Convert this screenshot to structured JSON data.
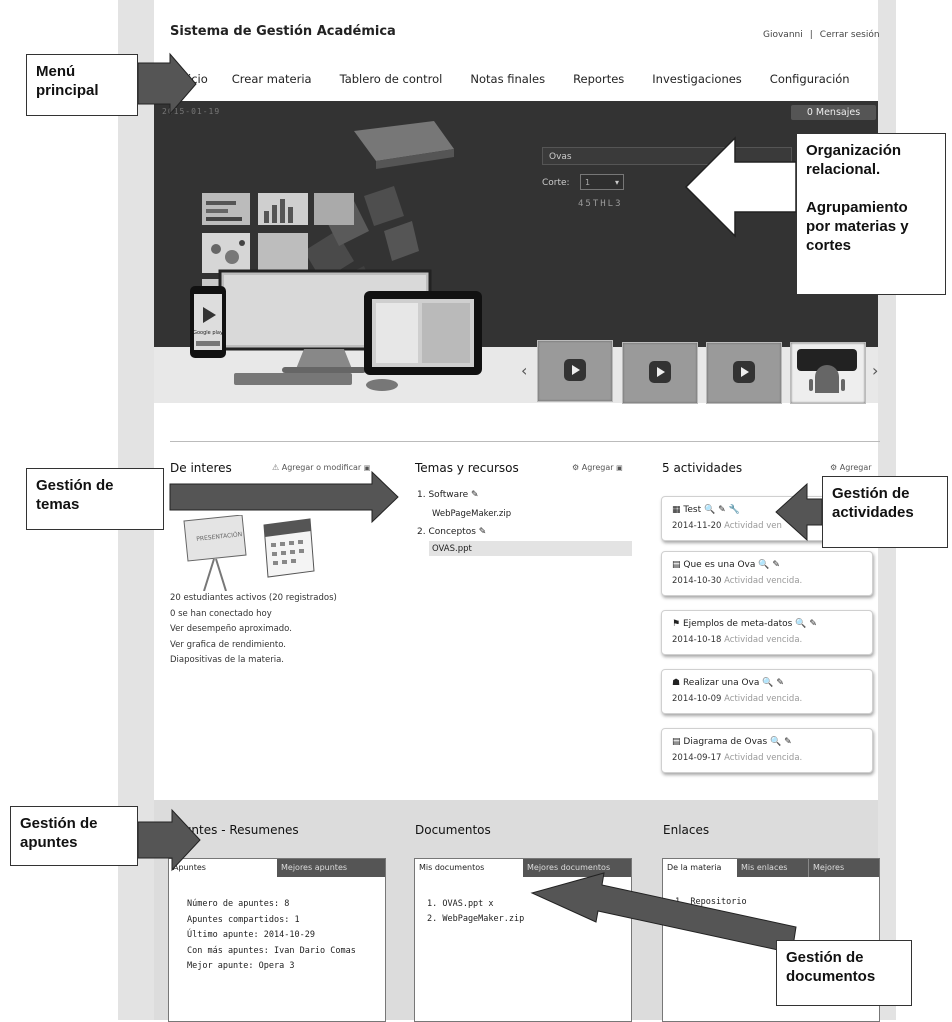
{
  "header": {
    "app_title": "Sistema de Gestión Académica",
    "user_name": "Giovanni",
    "separator": "|",
    "logout_label": "Cerrar sesión"
  },
  "nav": {
    "items": [
      "icio",
      "Crear materia",
      "Tablero de control",
      "Notas finales",
      "Reportes",
      "Investigaciones",
      "Configuración"
    ]
  },
  "banner": {
    "date": "2015-01-19",
    "messages_label": "0 Mensajes",
    "subject_value": "Ovas",
    "corte_label": "Corte:",
    "corte_value": "1",
    "corte_code": "45THL3",
    "store_label": "Google play"
  },
  "interest": {
    "title": "De interes",
    "edit_label": "Agregar o modificar",
    "lines": [
      "20 estudiantes activos (20 registrados)",
      "0 se han conectado hoy",
      "Ver desempeño aproximado.",
      "Ver grafica de rendimiento.",
      "Diapositivas de la materia."
    ],
    "board_text": "PRESENTACIÓN"
  },
  "topics": {
    "title": "Temas y recursos",
    "add_label": "Agregar",
    "items": [
      {
        "num": "1.",
        "name": "Software",
        "file": "WebPageMaker.zip"
      },
      {
        "num": "2.",
        "name": "Conceptos",
        "file": "OVAS.ppt"
      }
    ]
  },
  "activities": {
    "title": "5 actividades",
    "add_label": "Agregar",
    "status_text": "Actividad vencida.",
    "items": [
      {
        "name": "Test",
        "date": "2014-11-20",
        "status": "Actividad ven"
      },
      {
        "name": "Que es una Ova",
        "date": "2014-10-30",
        "status": "Actividad vencida."
      },
      {
        "name": "Ejemplos de meta-datos",
        "date": "2014-10-18",
        "status": "Actividad vencida."
      },
      {
        "name": "Realizar una Ova",
        "date": "2014-10-09",
        "status": "Actividad vencida."
      },
      {
        "name": "Diagrama de Ovas",
        "date": "2014-09-17",
        "status": "Actividad vencida."
      }
    ]
  },
  "notes": {
    "title": "Apuntes - Resumenes",
    "tabs": [
      "Apuntes",
      "Mejores apuntes"
    ],
    "lines": [
      "Número de apuntes: 8",
      "Apuntes compartidos: 1",
      "Último apunte: 2014-10-29",
      "Con más apuntes: Ivan Dario Comas",
      "Mejor apunte: Opera 3"
    ]
  },
  "documents": {
    "title": "Documentos",
    "tabs": [
      "Mis documentos",
      "Mejores documentos"
    ],
    "items": [
      "1.  OVAS.ppt x",
      "2.  WebPageMaker.zip"
    ]
  },
  "links": {
    "title": "Enlaces",
    "tabs": [
      "De la materia",
      "Mis enlaces",
      "Mejores"
    ],
    "items": [
      "1.  Repositorio"
    ]
  },
  "callouts": {
    "menu": "Menú\nprincipal",
    "org": "Organización\nrelacional.\n\nAgrupamiento\npor materias y\ncortes",
    "topics": "Gestión de\ntemas",
    "activities": "Gestión de\nactividades",
    "notes": "Gestión de\napuntes",
    "documents": "Gestión de\ndocumentos"
  },
  "colors": {
    "banner_bg": "#333333",
    "panel_tab_dark": "#555555",
    "status_grey": "#999999"
  }
}
